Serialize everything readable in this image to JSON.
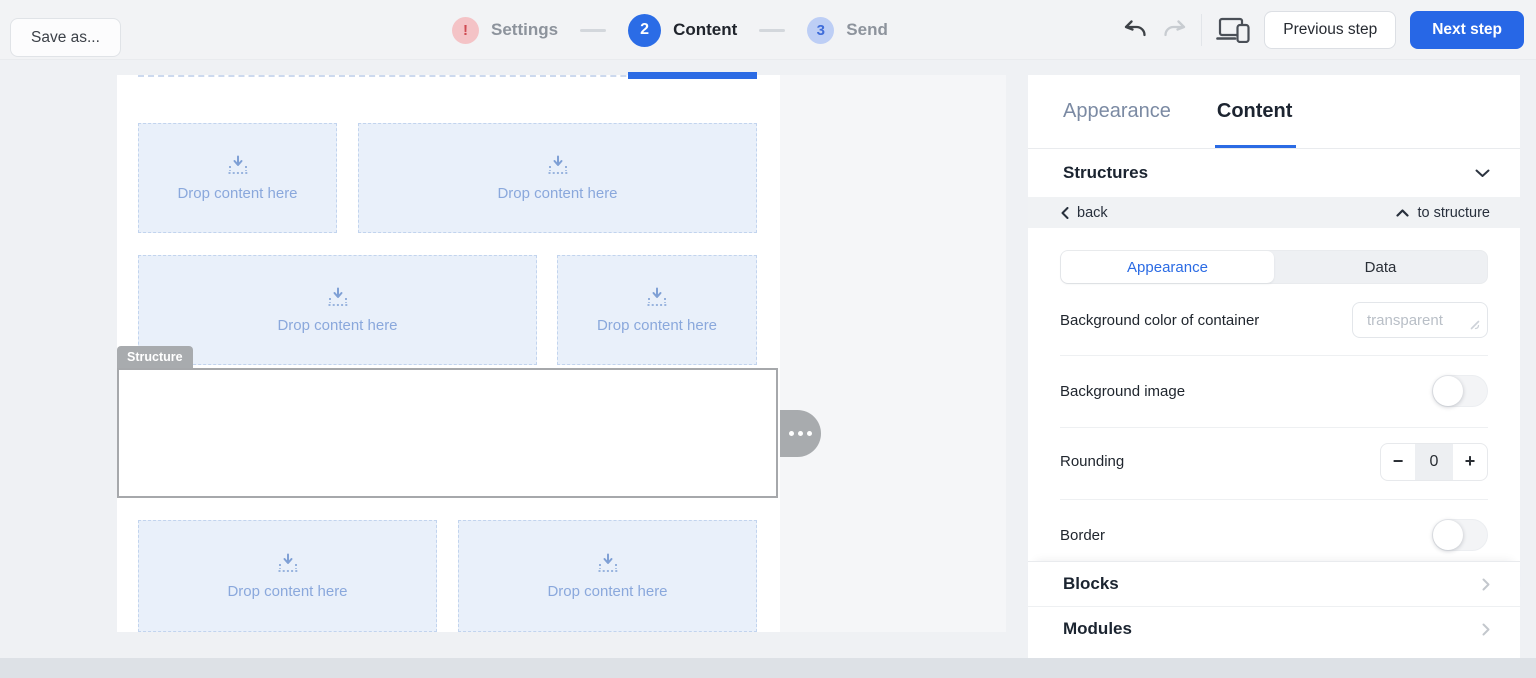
{
  "topbar": {
    "save_as_label": "Save as...",
    "steps": [
      {
        "badge": "!",
        "label": "Settings"
      },
      {
        "badge": "2",
        "label": "Content"
      },
      {
        "badge": "3",
        "label": "Send"
      }
    ],
    "previous_label": "Previous step",
    "next_label": "Next step"
  },
  "canvas": {
    "structure_tag": "Structure",
    "drop_label": "Drop content here"
  },
  "sidebar": {
    "tabs": {
      "appearance": "Appearance",
      "content": "Content"
    },
    "structures_label": "Structures",
    "back_label": "back",
    "to_structure_label": "to structure",
    "segmented": {
      "appearance": "Appearance",
      "data": "Data"
    },
    "rows": {
      "bg_color_label": "Background color of container",
      "bg_color_value": "transparent",
      "bg_image_label": "Background image",
      "rounding_label": "Rounding",
      "rounding_value": "0",
      "border_label": "Border",
      "blocks_label": "Blocks",
      "modules_label": "Modules"
    },
    "stepper": {
      "minus": "−",
      "plus": "+"
    }
  },
  "colors": {
    "accent_blue": "#2b6be4",
    "next_button": "#2767e6",
    "error_badge_bg": "#f4c3c6",
    "error_badge_fg": "#cf4b52",
    "upcoming_badge_bg": "#bdcef5",
    "upcoming_badge_fg": "#3f6cd9",
    "dropzone_bg": "#e9f0fa",
    "dropzone_border": "#c2d4ee",
    "dropzone_text": "#8aa8dc",
    "structure_gray": "#a8abae",
    "page_bg": "#eff1f4",
    "bottom_strip": "#dde1e6"
  }
}
